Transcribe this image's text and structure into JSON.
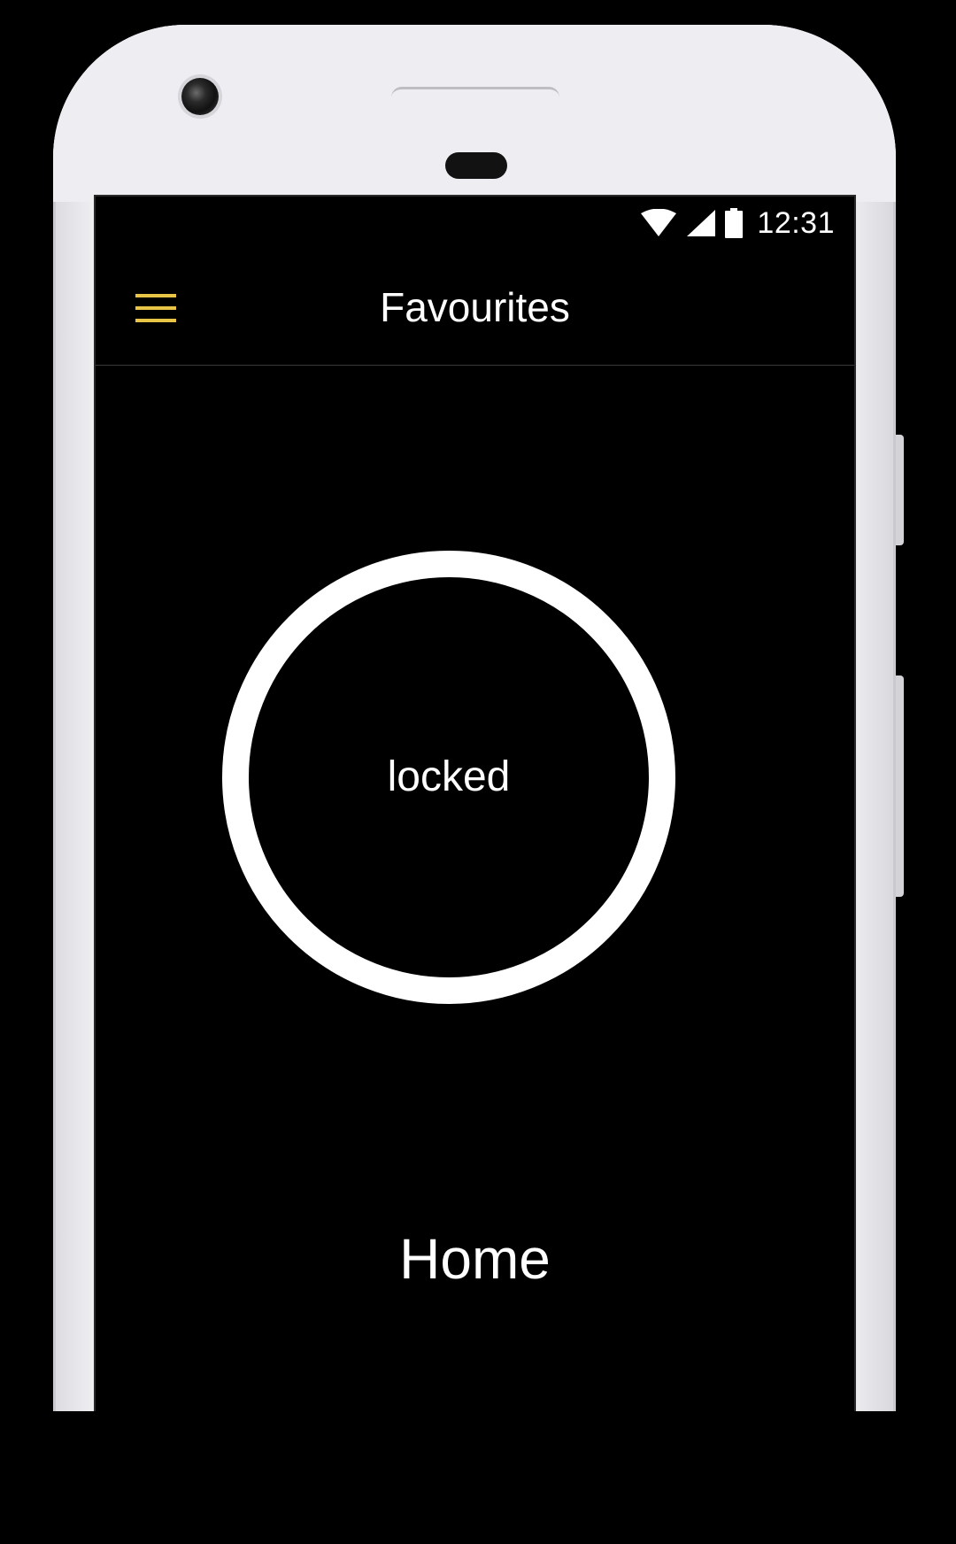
{
  "status_bar": {
    "time": "12:31",
    "icons": [
      "wifi-icon",
      "cell-signal-icon",
      "battery-icon"
    ]
  },
  "app_bar": {
    "title": "Favourites",
    "menu_icon": "hamburger-menu-icon",
    "accent_color": "#E8C547"
  },
  "main": {
    "lock_status": "locked",
    "place_name": "Home"
  },
  "colors": {
    "background": "#000000",
    "text": "#FFFFFF",
    "ring": "#FFFFFF",
    "accent": "#E8C547"
  }
}
